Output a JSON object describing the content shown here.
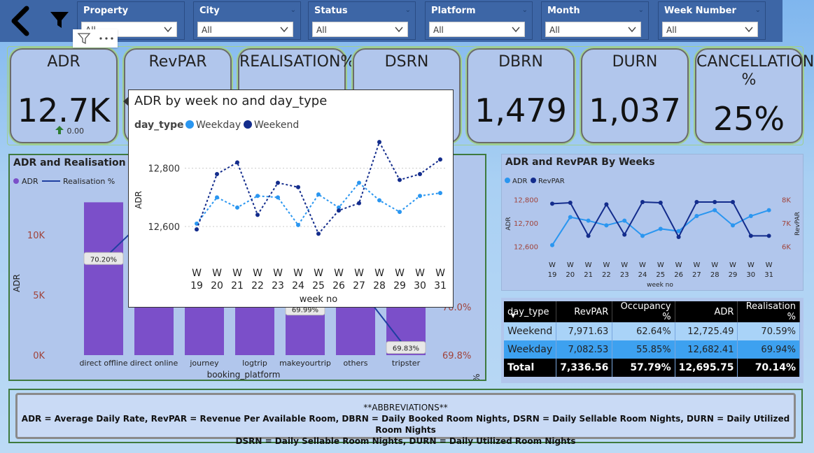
{
  "filters": [
    {
      "label": "Property",
      "value": "All"
    },
    {
      "label": "City",
      "value": "All"
    },
    {
      "label": "Status",
      "value": "All"
    },
    {
      "label": "Platform",
      "value": "All"
    },
    {
      "label": "Month",
      "value": "All"
    },
    {
      "label": "Week Number",
      "value": "All"
    }
  ],
  "kpis": [
    {
      "title": "ADR",
      "value": "12.7K",
      "change": "0.00"
    },
    {
      "title": "RevPAR",
      "value": ""
    },
    {
      "title": "REALISATION%",
      "value": ""
    },
    {
      "title": "DSRN",
      "value": ""
    },
    {
      "title": "DBRN",
      "value": "1,479"
    },
    {
      "title": "DURN",
      "value": "1,037"
    },
    {
      "title": "CANCELLATION\n%",
      "value": "25%"
    }
  ],
  "colors": {
    "adr_bar": "#7b4fc9",
    "realisation_line": "#1f3fa1",
    "weekday": "#2a96f0",
    "weekend": "#132c8c",
    "positive": "#2e7d32"
  },
  "left_chart": {
    "title": "ADR and Realisation % b",
    "legend": [
      "ADR",
      "Realisation %"
    ],
    "xlabel": "booking_platform",
    "ylabel": "ADR",
    "y2label": "Realisation %",
    "y_ticks": [
      "0K",
      "5K",
      "10K"
    ],
    "y2_ticks": [
      "69.8%",
      "70.0%",
      "%",
      "%",
      "%"
    ]
  },
  "right_chart": {
    "title": "ADR and RevPAR By Weeks",
    "legend": [
      "ADR",
      "RevPAR"
    ],
    "xlabel": "week no",
    "ylabel": "ADR",
    "y2label": "RevPAR",
    "y_ticks": [
      "12,600",
      "12,700",
      "12,800"
    ],
    "y2_ticks": [
      "6K",
      "7K",
      "8K"
    ]
  },
  "tooltip": {
    "title": "ADR by week no and day_type",
    "legend_title": "day_type",
    "legend": [
      "Weekday",
      "Weekend"
    ],
    "xlabel": "week no",
    "ylabel": "ADR",
    "y_ticks": [
      "12,600",
      "12,800"
    ]
  },
  "table": {
    "headers": [
      "day_type",
      "RevPAR",
      "Occupancy %",
      "ADR",
      "Realisation %"
    ],
    "rows": [
      [
        "Weekend",
        "7,971.63",
        "62.64%",
        "12,725.49",
        "70.59%"
      ],
      [
        "Weekday",
        "7,082.53",
        "55.85%",
        "12,682.41",
        "69.94%"
      ],
      [
        "Total",
        "7,336.56",
        "57.79%",
        "12,695.75",
        "70.14%"
      ]
    ]
  },
  "abbreviations": {
    "title": "**ABBREVIATIONS**",
    "line1": "ADR = Average Daily Rate, RevPAR = Revenue Per Available Room,   DBRN = Daily Booked Room Nights,   DSRN = Daily Sellable Room Nights,   DURN = Daily Utilized Room Nights",
    "line2": "DSRN = Daily Sellable Room Nights,   DURN = Daily Utilized Room Nights"
  },
  "chart_data": [
    {
      "type": "bar",
      "title": "ADR and Realisation % b",
      "xlabel": "booking_platform",
      "ylabel": "ADR",
      "y2label": "Realisation %",
      "categories": [
        "direct offline",
        "direct online",
        "journey",
        "logtrip",
        "makeyourtrip",
        "others",
        "tripster"
      ],
      "series": [
        {
          "name": "ADR",
          "type": "bar",
          "values": [
            12700,
            12700,
            12700,
            12700,
            12700,
            12700,
            12700
          ]
        },
        {
          "name": "Realisation %",
          "type": "line",
          "axis": "y2",
          "values": [
            70.2,
            70.4,
            70.35,
            70.25,
            69.99,
            70.1,
            69.83
          ]
        }
      ],
      "data_labels": [
        "70.20%",
        "",
        "",
        "",
        "69.99%",
        "",
        "69.83%"
      ],
      "ylim": [
        0,
        14000
      ],
      "y2lim": [
        69.8,
        70.5
      ]
    },
    {
      "type": "line",
      "title": "ADR and RevPAR By Weeks",
      "xlabel": "week no",
      "ylabel": "ADR",
      "y2label": "RevPAR",
      "x": [
        "W 19",
        "W 20",
        "W 21",
        "W 22",
        "W 23",
        "W 24",
        "W 25",
        "W 26",
        "W 27",
        "W 28",
        "W 29",
        "W 30",
        "W 31"
      ],
      "series": [
        {
          "name": "ADR",
          "axis": "y",
          "values": [
            12605,
            12725,
            12710,
            12690,
            12710,
            12645,
            12675,
            12665,
            12730,
            12755,
            12690,
            12730,
            12755
          ]
        },
        {
          "name": "RevPAR",
          "axis": "y2",
          "values": [
            7830,
            7870,
            6450,
            7800,
            6500,
            7900,
            7870,
            6400,
            7900,
            7900,
            7900,
            6450,
            6450
          ]
        }
      ],
      "ylim": [
        12580,
        12820
      ],
      "y2lim": [
        5800,
        8200
      ]
    },
    {
      "type": "line",
      "title": "ADR by week no and day_type",
      "xlabel": "week no",
      "ylabel": "ADR",
      "legend_title": "day_type",
      "x": [
        "W 19",
        "W 20",
        "W 21",
        "W 22",
        "W 23",
        "W 24",
        "W 25",
        "W 26",
        "W 27",
        "W 28",
        "W 29",
        "W 30",
        "W 31"
      ],
      "series": [
        {
          "name": "Weekday",
          "values": [
            12610,
            12700,
            12665,
            12705,
            12700,
            12605,
            12710,
            12665,
            12750,
            12690,
            12650,
            12705,
            12715
          ]
        },
        {
          "name": "Weekend",
          "values": [
            12590,
            12780,
            12820,
            12640,
            12750,
            12735,
            12575,
            12655,
            12680,
            12890,
            12760,
            12780,
            12830
          ]
        }
      ],
      "ylim": [
        12540,
        12900
      ]
    }
  ]
}
